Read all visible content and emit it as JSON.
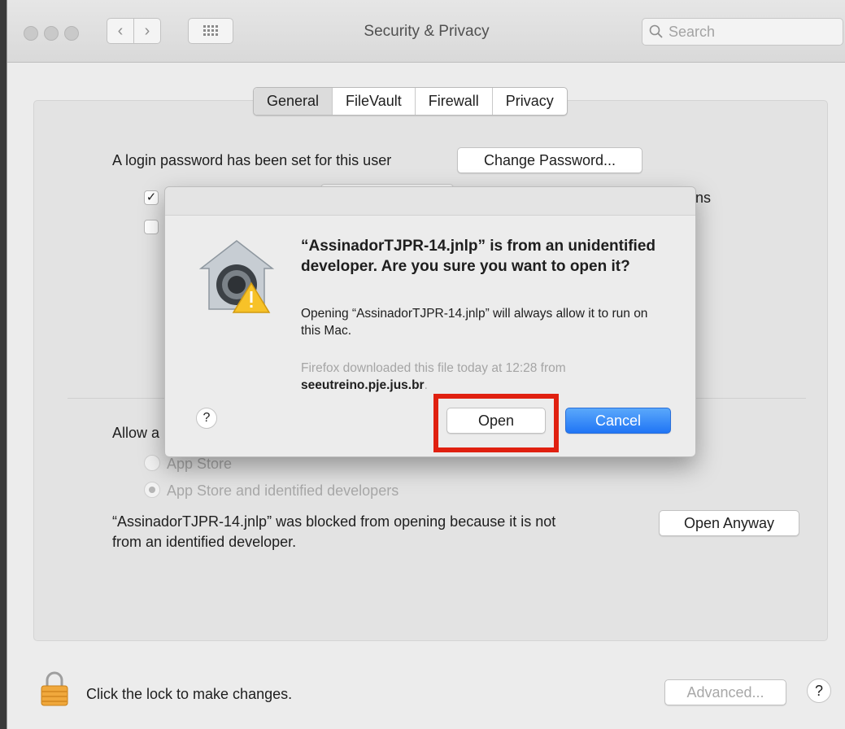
{
  "window": {
    "title": "Security & Privacy",
    "search_placeholder": "Search",
    "back_glyph": "‹",
    "forward_glyph": "›",
    "grid_icon": "grid-icon"
  },
  "tabs": [
    "General",
    "FileVault",
    "Firewall",
    "Privacy"
  ],
  "general": {
    "login_text": "A login password has been set for this user",
    "change_password_label": "Change Password...",
    "checkbox1_checked": "✓",
    "checkbox1_fragment": "ns",
    "allow_label_fragment": "Allow a",
    "radio_app_store": "App Store",
    "radio_identified": "App Store and identified developers",
    "blocked_line1": "“AssinadorTJPR-14.jnlp” was blocked from opening because it is not",
    "blocked_line2": "from an identified developer.",
    "open_anyway_label": "Open Anyway"
  },
  "footer": {
    "lock_text": "Click the lock to make changes.",
    "advanced_label": "Advanced...",
    "help_glyph": "?"
  },
  "dialog": {
    "heading": "“AssinadorTJPR-14.jnlp” is from an unidentified developer. Are you sure you want to open it?",
    "body": "Opening “AssinadorTJPR-14.jnlp” will always allow it to run on this Mac.",
    "source_text": "Firefox downloaded this file today at 12:28 from",
    "source_domain": "seeutreino.pje.jus.br",
    "source_end": ".",
    "help_glyph": "?",
    "open_label": "Open",
    "cancel_label": "Cancel",
    "highlight_color": "#e02010",
    "cancel_color": "#2075f5"
  }
}
